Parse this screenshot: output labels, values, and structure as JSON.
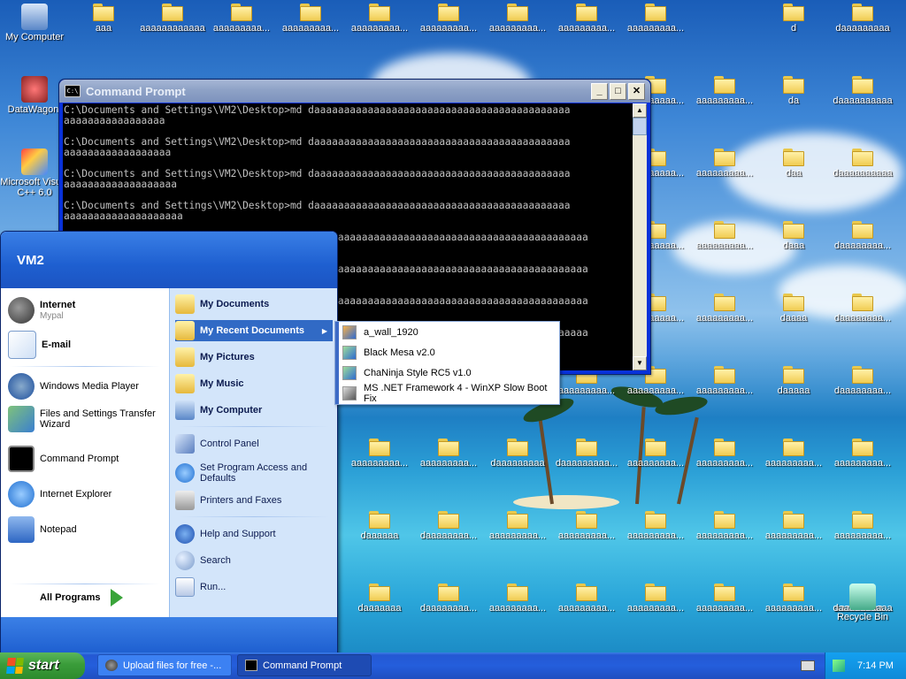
{
  "desktop": {
    "icons": [
      {
        "label": "My Computer",
        "type": "computer"
      },
      {
        "label": "DataWagon.",
        "type": "app"
      },
      {
        "label": "Microsoft Visual C++ 6.0",
        "type": "vc"
      },
      {
        "label": "aaa",
        "type": "folder"
      },
      {
        "label": "aaaaaaaaaaaa",
        "type": "folder"
      },
      {
        "label": "aaaaaaaaa...",
        "type": "folder"
      },
      {
        "label": "aaaaaaaaa...",
        "type": "folder"
      },
      {
        "label": "aaaaaaaaa...",
        "type": "folder"
      },
      {
        "label": "aaaaaaaaa...",
        "type": "folder"
      },
      {
        "label": "aaaaaaaaa...",
        "type": "folder"
      },
      {
        "label": "aaaaaaaaa...",
        "type": "folder"
      },
      {
        "label": "aaaaaaaaa...",
        "type": "folder"
      },
      {
        "label": "d",
        "type": "folder"
      },
      {
        "label": "daaaaaaaaa",
        "type": "folder"
      },
      {
        "label": "aaaaaaaaa...",
        "type": "folder"
      },
      {
        "label": "aaaaaaaaa...",
        "type": "folder"
      },
      {
        "label": "da",
        "type": "folder"
      },
      {
        "label": "daaaaaaaaaa",
        "type": "folder"
      },
      {
        "label": "aaaaaaaaa...",
        "type": "folder"
      },
      {
        "label": "aaaaaaaaa...",
        "type": "folder"
      },
      {
        "label": "daa",
        "type": "folder"
      },
      {
        "label": "daaaaaaaaaa",
        "type": "folder"
      },
      {
        "label": "aaaaaaaaa...",
        "type": "folder"
      },
      {
        "label": "aaaaaaaaa...",
        "type": "folder"
      },
      {
        "label": "daaa",
        "type": "folder"
      },
      {
        "label": "daaaaaaaa...",
        "type": "folder"
      },
      {
        "label": "aaaaaaaaa...",
        "type": "folder"
      },
      {
        "label": "aaaaaaaaa...",
        "type": "folder"
      },
      {
        "label": "daaaa",
        "type": "folder"
      },
      {
        "label": "daaaaaaaa...",
        "type": "folder"
      },
      {
        "label": "aaaaaaaaa...",
        "type": "folder"
      },
      {
        "label": "aaaaaaaaa...",
        "type": "folder"
      },
      {
        "label": "daaaaa",
        "type": "folder"
      },
      {
        "label": "daaaaaaaa...",
        "type": "folder"
      },
      {
        "label": "aaaaaaaaa...",
        "type": "folder"
      },
      {
        "label": "aaaaaaaaa...",
        "type": "folder"
      },
      {
        "label": "aaaaaaaaa...",
        "type": "folder"
      },
      {
        "label": "aaaaaaaaa...",
        "type": "folder"
      },
      {
        "label": "daaaaaa",
        "type": "folder"
      },
      {
        "label": "daaaaaaaa...",
        "type": "folder"
      },
      {
        "label": "aaaaaaaaa...",
        "type": "folder"
      },
      {
        "label": "aaaaaaaaa...",
        "type": "folder"
      },
      {
        "label": "aaaaaaaaa...",
        "type": "folder"
      },
      {
        "label": "aaaaaaaaa...",
        "type": "folder"
      },
      {
        "label": "aaaaaaaaa...",
        "type": "folder"
      },
      {
        "label": "aaaaaaaaa...",
        "type": "folder"
      },
      {
        "label": "daaaaaaa",
        "type": "folder"
      },
      {
        "label": "daaaaaaaa...",
        "type": "folder"
      },
      {
        "label": "aaaaaaaaa...",
        "type": "folder"
      },
      {
        "label": "aaaaaaaaa...",
        "type": "folder"
      },
      {
        "label": "aaaaaaaaa...",
        "type": "folder"
      },
      {
        "label": "aaaaaaaaa...",
        "type": "folder"
      },
      {
        "label": "aaaaaaaaa...",
        "type": "folder"
      },
      {
        "label": "aaaaaaaaa...",
        "type": "folder"
      },
      {
        "label": "daaaaaaaaa",
        "type": "folder"
      },
      {
        "label": "daaaaaaaaa...",
        "type": "folder"
      },
      {
        "label": "aaaaaaaaa...",
        "type": "folder"
      },
      {
        "label": "aaaaaaaaa...",
        "type": "folder"
      },
      {
        "label": "aaaaaaaaa...",
        "type": "folder"
      },
      {
        "label": "aaaaaaaaa...",
        "type": "folder"
      },
      {
        "label": "aaaaaaaaa...",
        "type": "folder"
      },
      {
        "label": "aaaaaaaaa...",
        "type": "folder"
      },
      {
        "label": "daaaaaaaaaa",
        "type": "folder"
      },
      {
        "label": "Recycle Bin",
        "type": "recycle"
      }
    ]
  },
  "cmd": {
    "title": "Command Prompt",
    "lines": [
      "C:\\Documents and Settings\\VM2\\Desktop>md daaaaaaaaaaaaaaaaaaaaaaaaaaaaaaaaaaaaaaaaaaa",
      "aaaaaaaaaaaaaaaaa",
      "",
      "C:\\Documents and Settings\\VM2\\Desktop>md daaaaaaaaaaaaaaaaaaaaaaaaaaaaaaaaaaaaaaaaaaa",
      "aaaaaaaaaaaaaaaaaa",
      "",
      "C:\\Documents and Settings\\VM2\\Desktop>md daaaaaaaaaaaaaaaaaaaaaaaaaaaaaaaaaaaaaaaaaaa",
      "aaaaaaaaaaaaaaaaaaa",
      "",
      "C:\\Documents and Settings\\VM2\\Desktop>md daaaaaaaaaaaaaaaaaaaaaaaaaaaaaaaaaaaaaaaaaaa",
      "aaaaaaaaaaaaaaaaaaaa",
      "",
      "                                         md daaaaaaaaaaaaaaaaaaaaaaaaaaaaaaaaaaaaaaaaaaa",
      "",
      "",
      "                                         md daaaaaaaaaaaaaaaaaaaaaaaaaaaaaaaaaaaaaaaaaaa",
      "",
      "",
      "                                         md daaaaaaaaaaaaaaaaaaaaaaaaaaaaaaaaaaaaaaaaaaa",
      "",
      "",
      "                                         md daaaaaaaaaaaaaaaaaaaaaaaaaaaaaaaaaaaaaaaaaaa"
    ]
  },
  "start_menu": {
    "user": "VM2",
    "pinned": [
      {
        "label": "Internet",
        "sub": "Mypal"
      },
      {
        "label": "E-mail",
        "sub": ""
      }
    ],
    "recent_programs": [
      "Windows Media Player",
      "Files and Settings Transfer Wizard",
      "Command Prompt",
      "Internet Explorer",
      "Notepad"
    ],
    "all_programs": "All Programs",
    "places": [
      "My Documents",
      "My Recent Documents",
      "My Pictures",
      "My Music",
      "My Computer"
    ],
    "system": [
      "Control Panel",
      "Set Program Access and Defaults",
      "Printers and Faxes"
    ],
    "help": [
      "Help and Support",
      "Search",
      "Run..."
    ]
  },
  "recent_docs": [
    "a_wall_1920",
    "Black Mesa v2.0",
    "ChaNinja Style RC5 v1.0",
    "MS .NET Framework 4 - WinXP Slow Boot Fix"
  ],
  "taskbar": {
    "start_label": "start",
    "buttons": [
      "Upload files for free -...",
      "Command Prompt"
    ],
    "clock": "7:14 PM"
  }
}
